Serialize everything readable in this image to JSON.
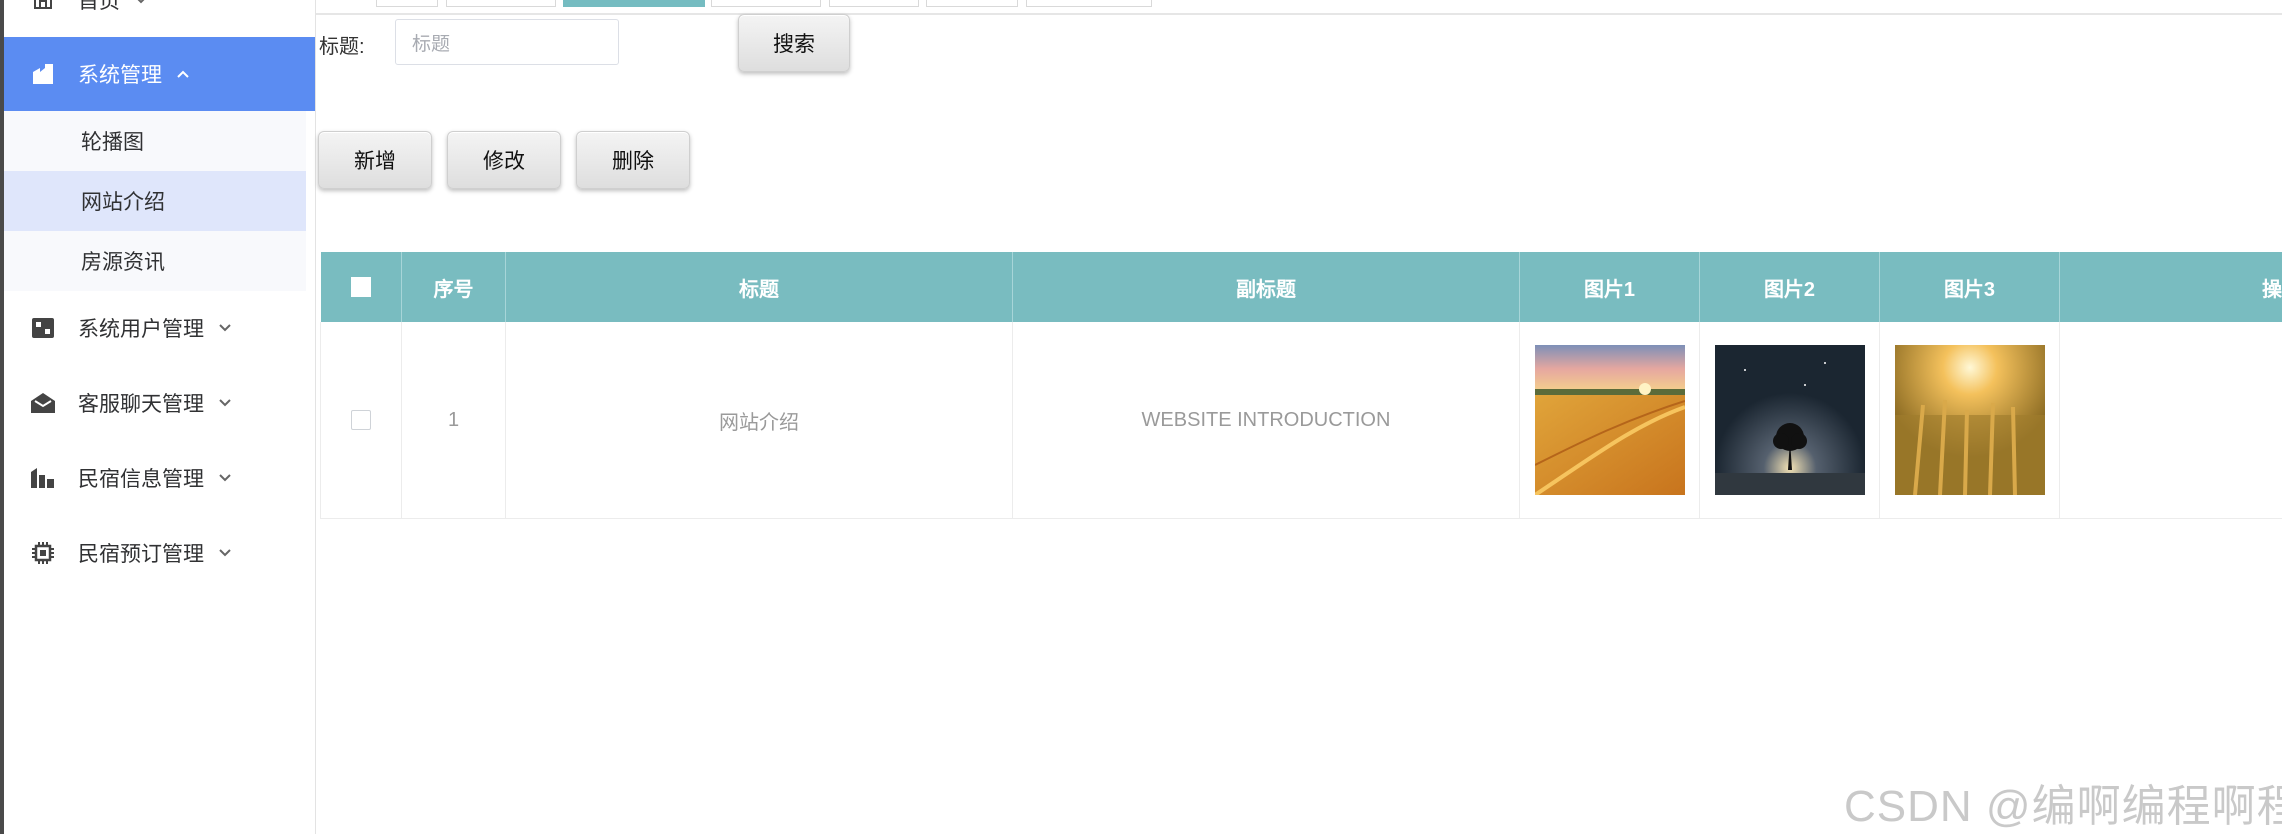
{
  "sidebar": {
    "home_label": "首页",
    "system_mgmt_label": "系统管理",
    "sub_items": [
      "轮播图",
      "网站介绍",
      "房源资讯"
    ],
    "menus": [
      "系统用户管理",
      "客服聊天管理",
      "民宿信息管理",
      "民宿预订管理"
    ],
    "active_color": "#5b8cf2"
  },
  "search": {
    "label": "标题:",
    "placeholder": "标题",
    "button": "搜索"
  },
  "toolbar": {
    "add": "新增",
    "edit": "修改",
    "delete": "删除"
  },
  "table": {
    "headers": [
      "序号",
      "标题",
      "副标题",
      "图片1",
      "图片2",
      "图片3",
      "操"
    ],
    "header_color": "#79bcc0",
    "rows": [
      {
        "index": "1",
        "title": "网站介绍",
        "subtitle": "WEBSITE INTRODUCTION",
        "images": [
          "wheat-field-sunset",
          "night-tree-stars",
          "golden-wheat"
        ]
      }
    ]
  },
  "watermark": "CSDN @编啊编程啊程"
}
